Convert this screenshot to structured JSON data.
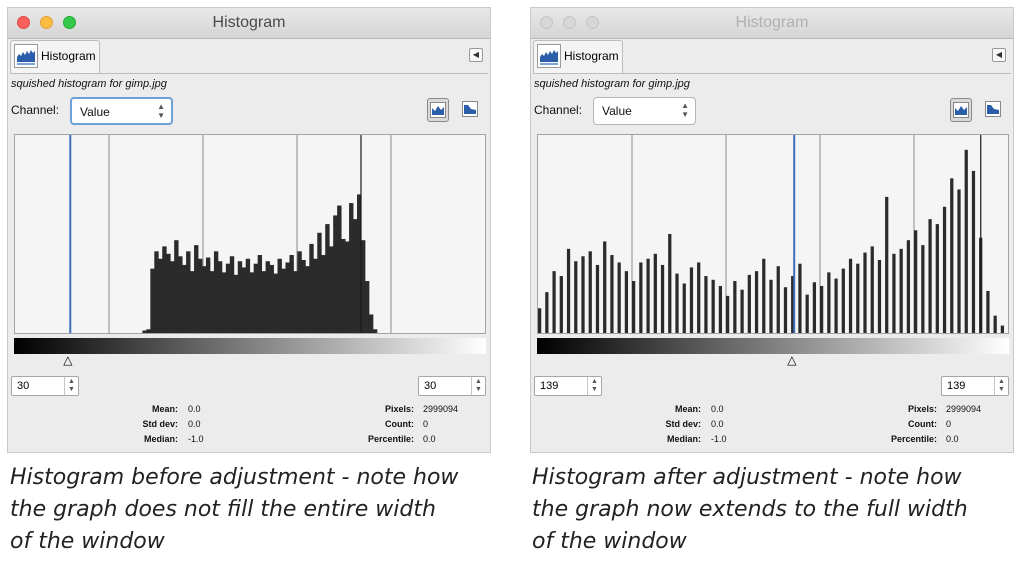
{
  "left": {
    "window_title": "Histogram",
    "tab_label": "Histogram",
    "image_name": "squished histogram for gimp.jpg",
    "channel_label": "Channel:",
    "channel_value": "Value",
    "range_low": "30",
    "range_high": "30",
    "stats": {
      "mean_label": "Mean:",
      "mean": "0.0",
      "std_label": "Std dev:",
      "std": "0.0",
      "median_label": "Median:",
      "median": "-1.0",
      "pixels_label": "Pixels:",
      "pixels": "2999094",
      "count_label": "Count:",
      "count": "0",
      "percentile_label": "Percentile:",
      "percentile": "0.0"
    },
    "histogram_levels": [
      0.02,
      0.03,
      0.52,
      0.66,
      0.6,
      0.7,
      0.64,
      0.58,
      0.75,
      0.62,
      0.55,
      0.66,
      0.5,
      0.71,
      0.6,
      0.54,
      0.61,
      0.5,
      0.66,
      0.58,
      0.49,
      0.56,
      0.62,
      0.47,
      0.58,
      0.53,
      0.6,
      0.49,
      0.56,
      0.63,
      0.5,
      0.58,
      0.55,
      0.48,
      0.6,
      0.52,
      0.57,
      0.63,
      0.5,
      0.66,
      0.59,
      0.54,
      0.72,
      0.6,
      0.81,
      0.63,
      0.88,
      0.7,
      0.95,
      1.03,
      0.76,
      0.74,
      1.05,
      0.92,
      1.12,
      0.75,
      0.42,
      0.15,
      0.03
    ],
    "histogram_start": 0.271,
    "histogram_end": 0.77,
    "marker_value": 30,
    "caption_lines": [
      "Histogram before adjustment - note how",
      "the graph does not fill the entire width",
      "of the window"
    ]
  },
  "right": {
    "window_title": "Histogram",
    "tab_label": "Histogram",
    "image_name": "squished histogram for gimp.jpg",
    "channel_label": "Channel:",
    "channel_value": "Value",
    "range_low": "139",
    "range_high": "139",
    "stats": {
      "mean_label": "Mean:",
      "mean": "0.0",
      "std_label": "Std dev:",
      "std": "0.0",
      "median_label": "Median:",
      "median": "-1.0",
      "pixels_label": "Pixels:",
      "pixels": "2999094",
      "count_label": "Count:",
      "count": "0",
      "percentile_label": "Percentile:",
      "percentile": "0.0"
    },
    "histogram_levels": [
      0.2,
      0.33,
      0.5,
      0.46,
      0.68,
      0.58,
      0.62,
      0.66,
      0.55,
      0.74,
      0.63,
      0.57,
      0.5,
      0.42,
      0.57,
      0.6,
      0.64,
      0.55,
      0.8,
      0.48,
      0.4,
      0.53,
      0.57,
      0.46,
      0.43,
      0.38,
      0.3,
      0.42,
      0.35,
      0.47,
      0.5,
      0.6,
      0.43,
      0.54,
      0.37,
      0.46,
      0.56,
      0.31,
      0.41,
      0.38,
      0.49,
      0.44,
      0.52,
      0.6,
      0.56,
      0.65,
      0.7,
      0.59,
      1.1,
      0.64,
      0.68,
      0.75,
      0.83,
      0.71,
      0.92,
      0.88,
      1.02,
      1.25,
      1.16,
      1.48,
      1.31,
      0.77,
      0.34,
      0.14,
      0.06
    ],
    "histogram_start": 0.0,
    "histogram_end": 1.0,
    "marker_value": 139,
    "caption_lines": [
      "Histogram after adjustment - note how",
      "the graph now extends to the full width",
      "of the window"
    ]
  }
}
